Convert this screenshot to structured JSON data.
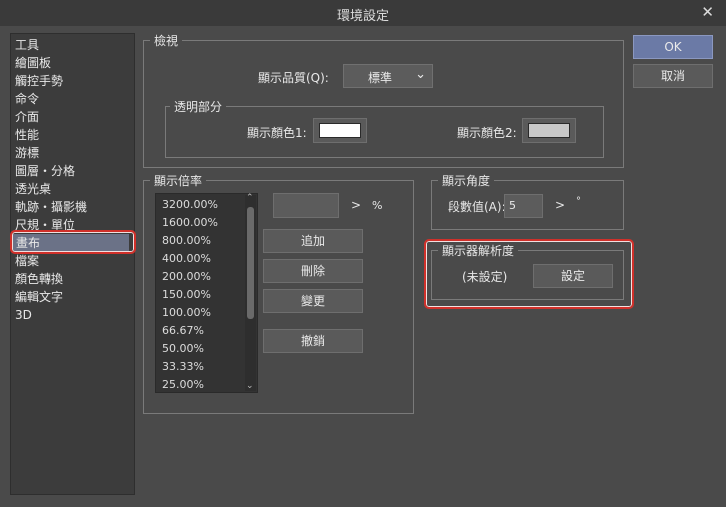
{
  "window": {
    "title": "環境設定",
    "close": "✕"
  },
  "sidebar": {
    "items": [
      "工具",
      "繪圖板",
      "觸控手勢",
      "命令",
      "介面",
      "性能",
      "游標",
      "圖層・分格",
      "透光桌",
      "軌跡・攝影機",
      "尺規・單位",
      "畫布",
      "檔案",
      "顏色轉換",
      "編輯文字",
      "3D"
    ],
    "selected": "畫布"
  },
  "buttons": {
    "ok": "OK",
    "cancel": "取消"
  },
  "preview": {
    "legend": "檢視",
    "quality_label": "顯示品質(Q):",
    "quality_value": "標準",
    "transparent": {
      "legend": "透明部分",
      "color1_label": "顯示顏色1:",
      "color2_label": "顯示顏色2:",
      "color1": "#ffffff",
      "color2": "#c8c8c8"
    }
  },
  "zoom": {
    "legend": "顯示倍率",
    "values": [
      "3200.00%",
      "1600.00%",
      "800.00%",
      "400.00%",
      "200.00%",
      "150.00%",
      "100.00%",
      "66.67%",
      "50.00%",
      "33.33%",
      "25.00%"
    ],
    "input_value": "",
    "arrow": ">",
    "unit": "%",
    "add": "追加",
    "delete": "刪除",
    "change": "變更",
    "undo": "撤銷"
  },
  "angle": {
    "legend": "顯示角度",
    "steps_label": "段數值(A):",
    "steps_value": "5",
    "arrow": ">",
    "unit": "°"
  },
  "resolution": {
    "legend": "顯示器解析度",
    "status": "(未設定)",
    "set": "設定"
  },
  "colors": {
    "accent": "#6b7aa6",
    "highlight": "#d0302a",
    "selected": "#6b7287"
  }
}
